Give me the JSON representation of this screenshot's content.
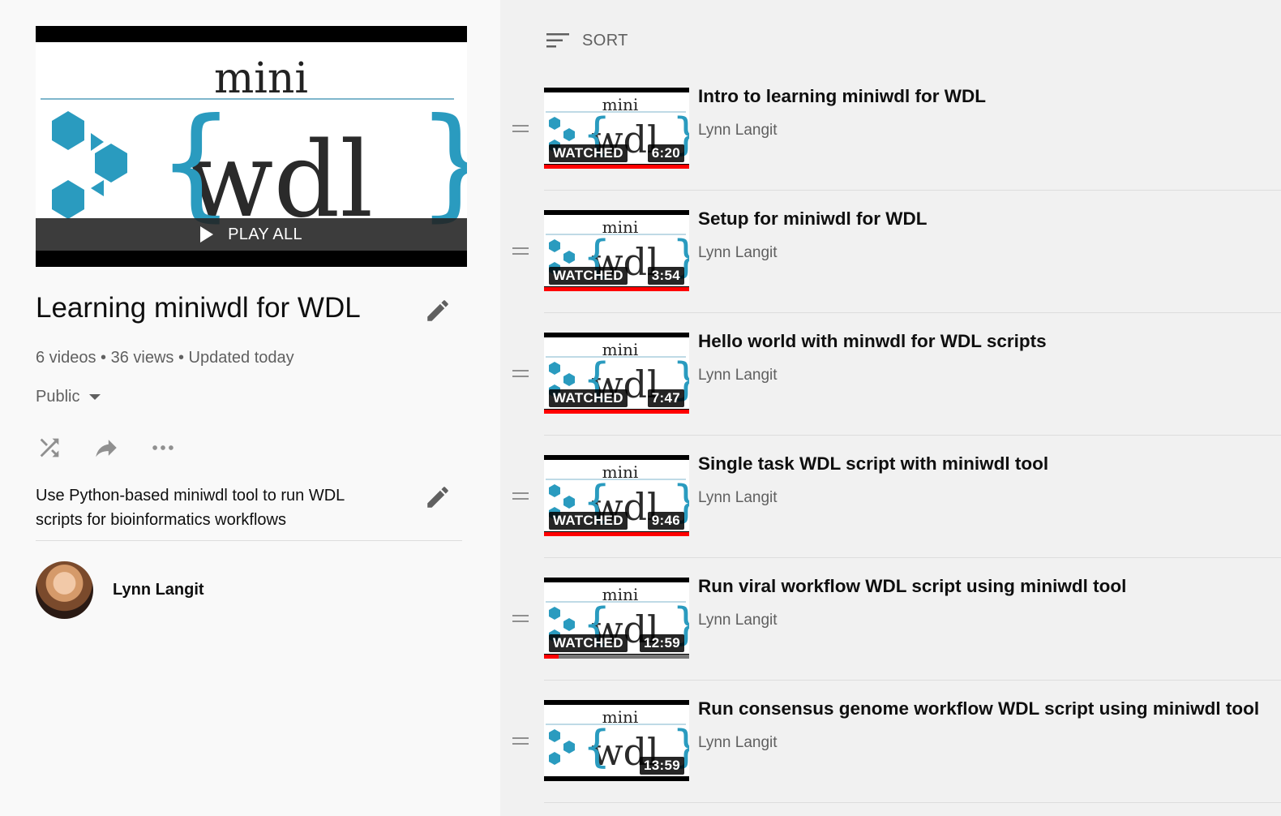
{
  "playlist": {
    "play_all_label": "PLAY ALL",
    "title": "Learning miniwdl for WDL",
    "stats": "6 videos • 36 views • Updated today",
    "privacy": "Public",
    "description": "Use Python-based miniwdl tool to run WDL scripts for bioinformatics workflows",
    "owner": "Lynn Langit",
    "thumb_text_top": "mini",
    "thumb_text_main": "wdl"
  },
  "sort_label": "SORT",
  "watched_label": "WATCHED",
  "colors": {
    "accent_red": "#ff0000",
    "logo_blue": "#2a9bbf"
  },
  "videos": [
    {
      "title": "Intro to learning miniwdl for WDL",
      "channel": "Lynn Langit",
      "duration": "6:20",
      "watched": true,
      "progress": 1.0
    },
    {
      "title": "Setup for miniwdl for WDL",
      "channel": "Lynn Langit",
      "duration": "3:54",
      "watched": true,
      "progress": 1.0
    },
    {
      "title": "Hello world with minwdl for WDL scripts",
      "channel": "Lynn Langit",
      "duration": "7:47",
      "watched": true,
      "progress": 1.0
    },
    {
      "title": "Single task WDL script with miniwdl tool",
      "channel": "Lynn Langit",
      "duration": "9:46",
      "watched": true,
      "progress": 1.0
    },
    {
      "title": "Run viral workflow WDL script using miniwdl tool",
      "channel": "Lynn Langit",
      "duration": "12:59",
      "watched": true,
      "progress": 0.1
    },
    {
      "title": "Run consensus genome workflow WDL script using miniwdl tool",
      "channel": "Lynn Langit",
      "duration": "13:59",
      "watched": false,
      "progress": 0
    }
  ]
}
